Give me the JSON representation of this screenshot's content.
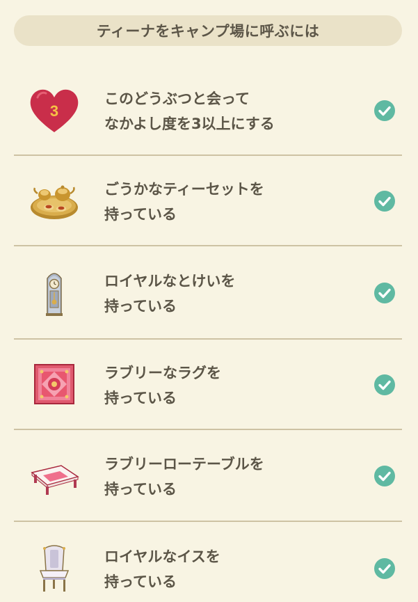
{
  "header": {
    "title": "ティーナをキャンプ場に呼ぶには"
  },
  "colors": {
    "background": "#f8f4e3",
    "header_bg": "#eae2c8",
    "check": "#5fb9a2",
    "heart": "#c92e4a",
    "heart_number": "#f5c244",
    "divider": "#cdc2a3",
    "text": "#5b5547"
  },
  "conditions": [
    {
      "icon": "heart-icon",
      "heart_number": "3",
      "line1": "このどうぶつと会って",
      "line2": "なかよし度を3以上にする",
      "status_icon": "check-icon",
      "completed": true
    },
    {
      "icon": "tea-set-icon",
      "line1": "ごうかなティーセットを",
      "line2": "持っている",
      "status_icon": "check-icon",
      "completed": true
    },
    {
      "icon": "royal-clock-icon",
      "line1": "ロイヤルなとけいを",
      "line2": "持っている",
      "status_icon": "check-icon",
      "completed": true
    },
    {
      "icon": "lovely-rug-icon",
      "line1": "ラブリーなラグを",
      "line2": "持っている",
      "status_icon": "check-icon",
      "completed": true
    },
    {
      "icon": "lovely-low-table-icon",
      "line1": "ラブリーローテーブルを",
      "line2": "持っている",
      "status_icon": "check-icon",
      "completed": true
    },
    {
      "icon": "royal-chair-icon",
      "line1": "ロイヤルなイスを",
      "line2": "持っている",
      "status_icon": "check-icon",
      "completed": true
    }
  ]
}
